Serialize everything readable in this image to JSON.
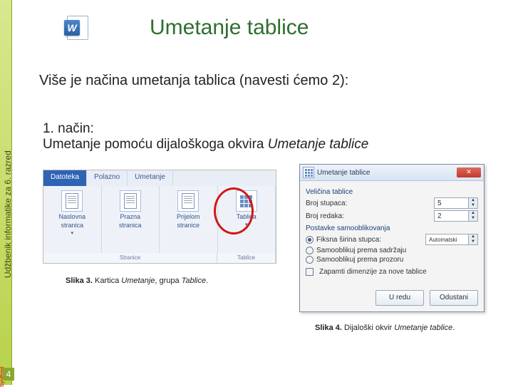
{
  "spine": {
    "text": "Udžbenik informatike za 6. razred",
    "brand": "SysPrint"
  },
  "page_number": "4",
  "title": "Umetanje tablice",
  "intro": "Više je načina umetanja tablica (navesti ćemo 2):",
  "method1": {
    "num": "1.  način:",
    "line": "Umetanje pomoću dijaloškoga okvira ",
    "ital": "Umetanje tablice"
  },
  "ribbon": {
    "tabs": {
      "t1": "Datoteka",
      "t2": "Polazno",
      "t3": "Umetanje"
    },
    "groups": {
      "g1": {
        "l1": "Naslovna",
        "l2": "stranica",
        "dd": "▾"
      },
      "g2": {
        "l1": "Prazna",
        "l2": "stranica"
      },
      "g3": {
        "l1": "Prijelom",
        "l2": "stranice"
      },
      "g4": {
        "l1": "Tablica",
        "dd": "▾"
      }
    },
    "footer": {
      "f1": "Stranice",
      "f2": "Tablice"
    }
  },
  "caption3": {
    "b": "Slika 3.",
    "rest": " Kartica ",
    "i1": "Umetanje",
    "mid": ", grupa ",
    "i2": "Tablice",
    "end": "."
  },
  "dialog": {
    "title": "Umetanje tablice",
    "sec1": "Veličina tablice",
    "row1": {
      "label": "Broj stupaca:",
      "val": "5"
    },
    "row2": {
      "label": "Broj redaka:",
      "val": "2"
    },
    "sec2": "Postavke samooblikovanja",
    "r1": "Fiksna širina stupca:",
    "r1v": "Automatski",
    "r2": "Samooblikuj prema sadržaju",
    "r3": "Samooblikuj prema prozoru",
    "chk": "Zapamti dimenzije za nove tablice",
    "ok": "U redu",
    "cancel": "Odustani"
  },
  "caption4": {
    "b": "Slika 4.",
    "rest": " Dijaloški okvir ",
    "i": "Umetanje tablice",
    "end": "."
  }
}
